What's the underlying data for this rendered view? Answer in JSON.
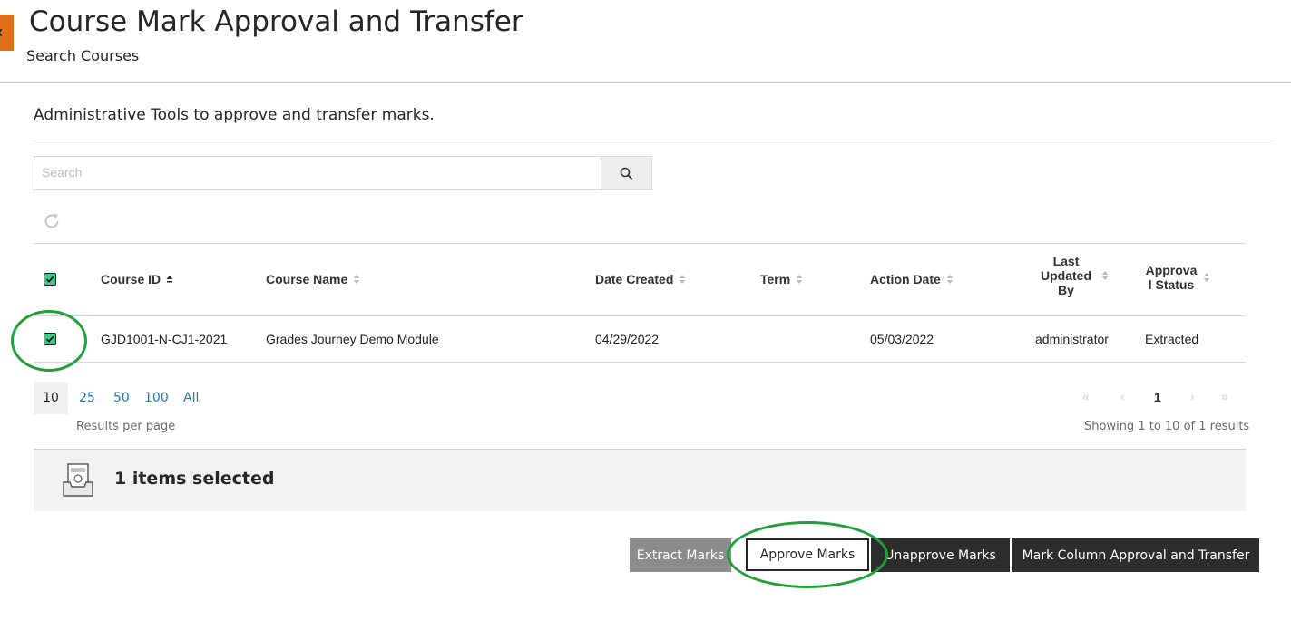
{
  "header": {
    "title": "Course Mark Approval and Transfer",
    "subtitle": "Search Courses"
  },
  "intro": "Administrative Tools to approve and transfer marks.",
  "search": {
    "placeholder": "Search",
    "value": ""
  },
  "table": {
    "columns": [
      {
        "key": "course_id",
        "label": "Course ID"
      },
      {
        "key": "course_name",
        "label": "Course Name"
      },
      {
        "key": "date_created",
        "label": "Date Created"
      },
      {
        "key": "term",
        "label": "Term"
      },
      {
        "key": "action_date",
        "label": "Action Date"
      },
      {
        "key": "last_updated_by",
        "label": "Last Updated By"
      },
      {
        "key": "approval_status",
        "label": "Approval Status"
      }
    ],
    "rows": [
      {
        "selected": true,
        "course_id": "GJD1001-N-CJ1-2021",
        "course_name": "Grades Journey Demo Module",
        "date_created": "04/29/2022",
        "term": "",
        "action_date": "05/03/2022",
        "last_updated_by": "administrator",
        "approval_status": "Extracted"
      }
    ]
  },
  "per_page": {
    "options": [
      "10",
      "25",
      "50",
      "100",
      "All"
    ],
    "selected": "10",
    "label": "Results per page"
  },
  "pagination": {
    "current_page": "1",
    "summary": "Showing 1 to 10 of 1 results",
    "first": "«",
    "prev": "‹",
    "next": "›",
    "last": "»"
  },
  "selection": {
    "text": "1 items selected"
  },
  "actions": {
    "extract": "Extract Marks",
    "approve": "Approve Marks",
    "unapprove": "Unapprove Marks",
    "transfer": "Mark Column Approval and Transfer"
  },
  "colors": {
    "accent_orange": "#e07018",
    "checkbox_green": "#3bcb8f",
    "annotation_green": "#22a03a",
    "link_blue": "#1f78b4",
    "dark_button": "#2d2d2d",
    "disabled_button": "#8c8c8c"
  },
  "icons": {
    "back": "chevron-left-icon",
    "search": "search-icon",
    "refresh": "refresh-icon",
    "selection": "tray-icon",
    "sort": "sort-icon"
  }
}
